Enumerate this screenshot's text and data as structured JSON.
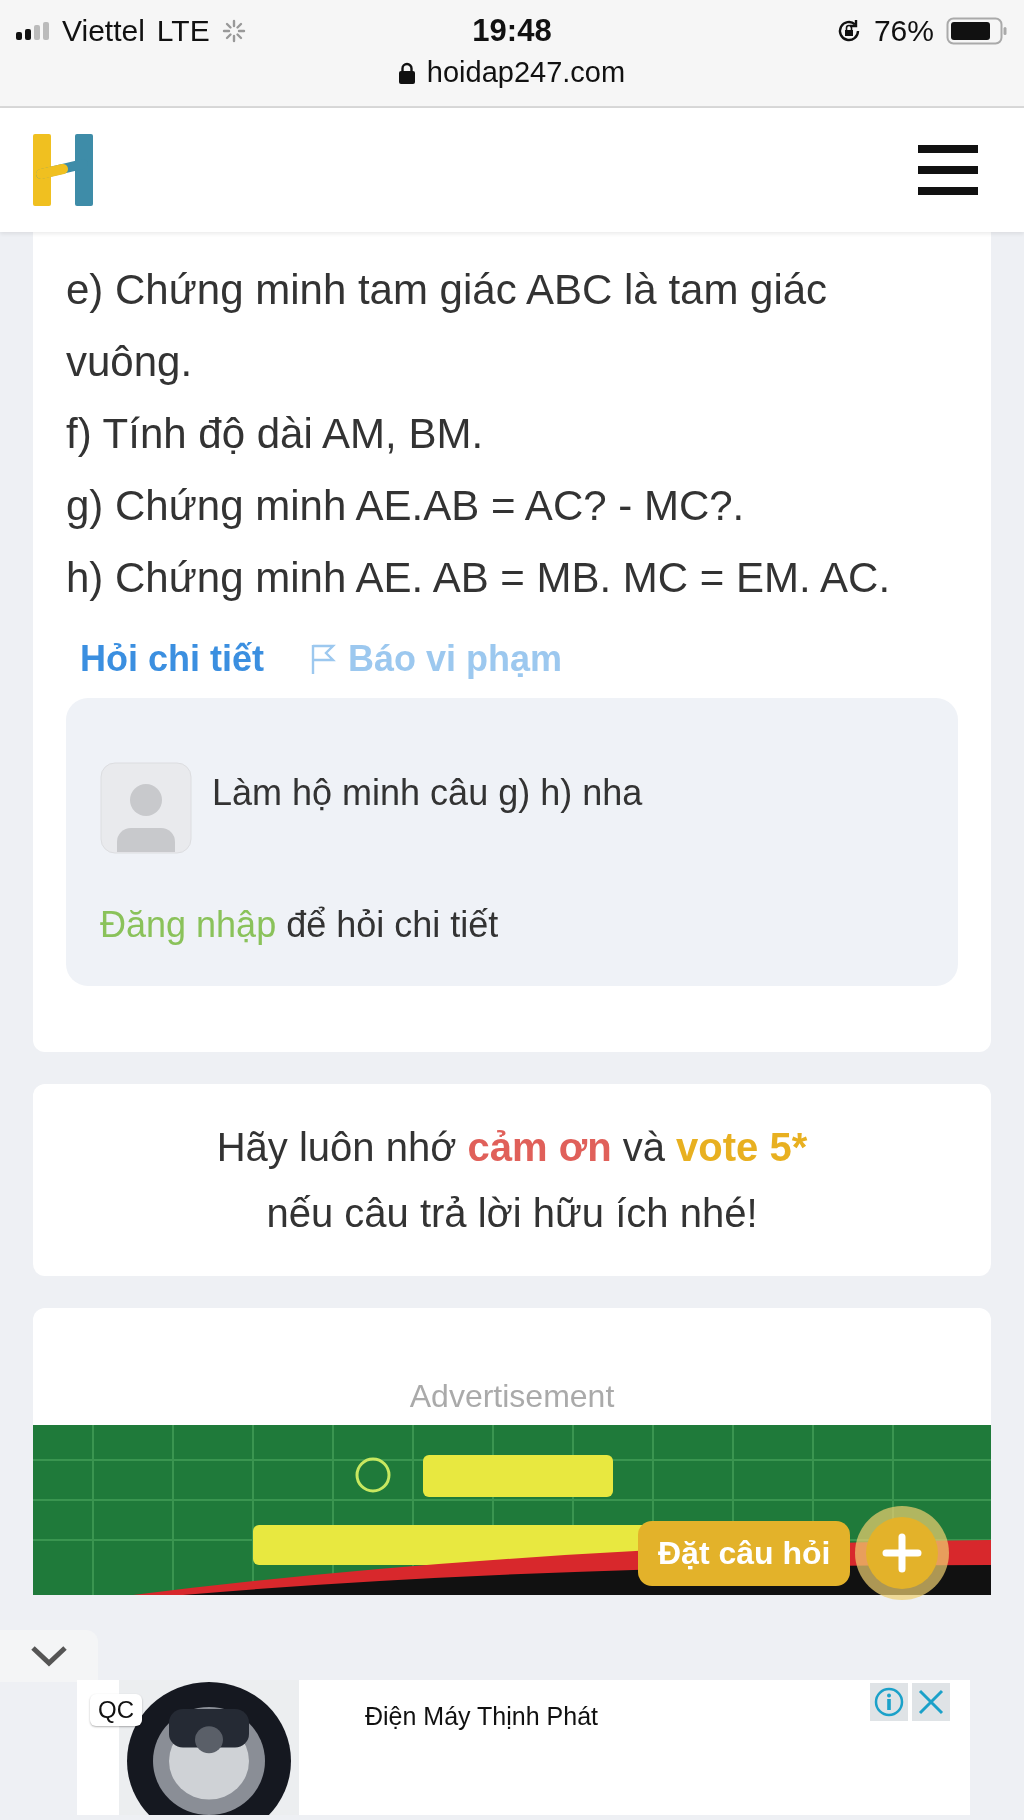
{
  "status_bar": {
    "carrier": "Viettel",
    "network": "LTE",
    "time": "19:48",
    "battery": "76%",
    "url": "hoidap247.com"
  },
  "question": {
    "lines": [
      "e) Chứng minh tam giác ABC là tam giác vuông.",
      "f) Tính độ dài AM, BM.",
      "g) Chứng minh AE.AB = AC? - MC?.",
      "h) Chứng minh AE. AB = MB. MC = EM. AC."
    ]
  },
  "actions": [
    {
      "label": "Hỏi chi tiết",
      "kind": "ask"
    },
    {
      "label": "Báo vi phạm",
      "kind": "report"
    }
  ],
  "comment": {
    "text": "Làm hộ minh câu g) h) nha",
    "login_link": "Đăng nhập",
    "login_text": "để hỏi chi tiết"
  },
  "reminder": {
    "lines": [
      [
        {
          "text": "Hãy luôn nhớ ",
          "kind": "plain"
        },
        {
          "text": "cảm ơn",
          "kind": "thanks"
        },
        {
          "text": " và ",
          "kind": "plain"
        },
        {
          "text": "vote 5*",
          "kind": "vote"
        }
      ],
      [
        {
          "text": "nếu câu trả lời hữu ích nhé!",
          "kind": "plain"
        }
      ]
    ]
  },
  "advertisement": {
    "label": "Advertisement"
  },
  "ask_button": {
    "label": "Đặt câu hỏi"
  },
  "bottom_ad": {
    "badge": "QC",
    "advertiser": "Điện Máy Thịnh Phát"
  }
}
